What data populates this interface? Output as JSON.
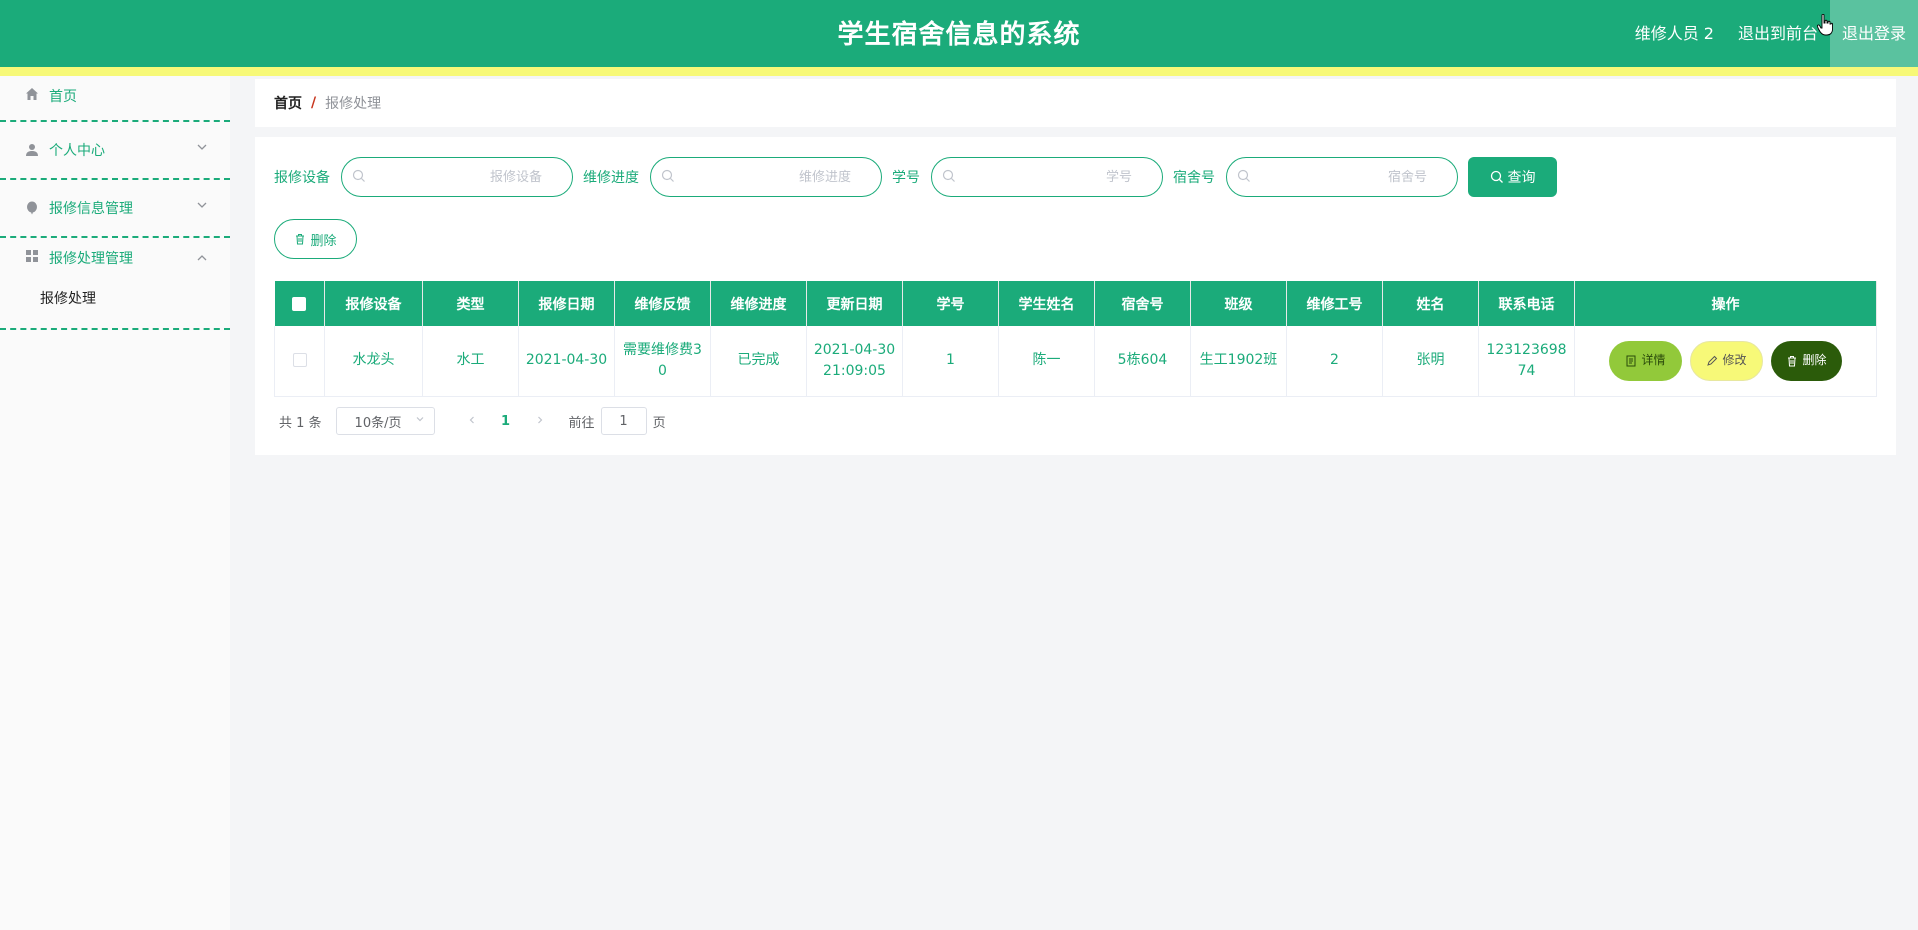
{
  "header": {
    "title": "学生宿舍信息的系统",
    "user": "维修人员 2",
    "to_front": "退出到前台",
    "logout": "退出登录"
  },
  "sidebar": {
    "items": [
      {
        "label": "首页",
        "icon": "home-icon"
      },
      {
        "label": "个人中心",
        "icon": "user-icon"
      },
      {
        "label": "报修信息管理",
        "icon": "balloon-icon"
      },
      {
        "label": "报修处理管理",
        "icon": "grid-icon",
        "children": [
          {
            "label": "报修处理"
          }
        ]
      }
    ]
  },
  "breadcrumb": {
    "home": "首页",
    "separator": "/",
    "current": "报修处理"
  },
  "search": {
    "fields": [
      {
        "label": "报修设备",
        "placeholder": "报修设备"
      },
      {
        "label": "维修进度",
        "placeholder": "维修进度"
      },
      {
        "label": "学号",
        "placeholder": "学号"
      },
      {
        "label": "宿舍号",
        "placeholder": "宿舍号"
      }
    ],
    "query_label": "查询"
  },
  "actions": {
    "delete_label": "删除"
  },
  "table": {
    "columns": [
      "报修设备",
      "类型",
      "报修日期",
      "维修反馈",
      "维修进度",
      "更新日期",
      "学号",
      "学生姓名",
      "宿舍号",
      "班级",
      "维修工号",
      "姓名",
      "联系电话",
      "操作"
    ],
    "rows": [
      {
        "device": "水龙头",
        "type": "水工",
        "report_date": "2021-04-30",
        "feedback": "需要维修费30",
        "progress": "已完成",
        "update_date": "2021-04-30 21:09:05",
        "student_no": "1",
        "student_name": "陈一",
        "dorm": "5栋604",
        "class": "生工1902班",
        "worker_no": "2",
        "worker_name": "张明",
        "phone": "12312369874",
        "ops": {
          "detail": "详情",
          "edit": "修改",
          "delete": "删除"
        }
      }
    ]
  },
  "pagination": {
    "total": "共 1 条",
    "page_size": "10条/页",
    "current_page": "1",
    "goto_prefix": "前往",
    "goto_value": "1",
    "goto_suffix": "页"
  },
  "colors": {
    "primary": "#1bab7a",
    "stripe": "#f7f978",
    "detail_btn": "#92c93a",
    "edit_btn": "#f7f978",
    "delete_btn": "#2b5b0a"
  }
}
